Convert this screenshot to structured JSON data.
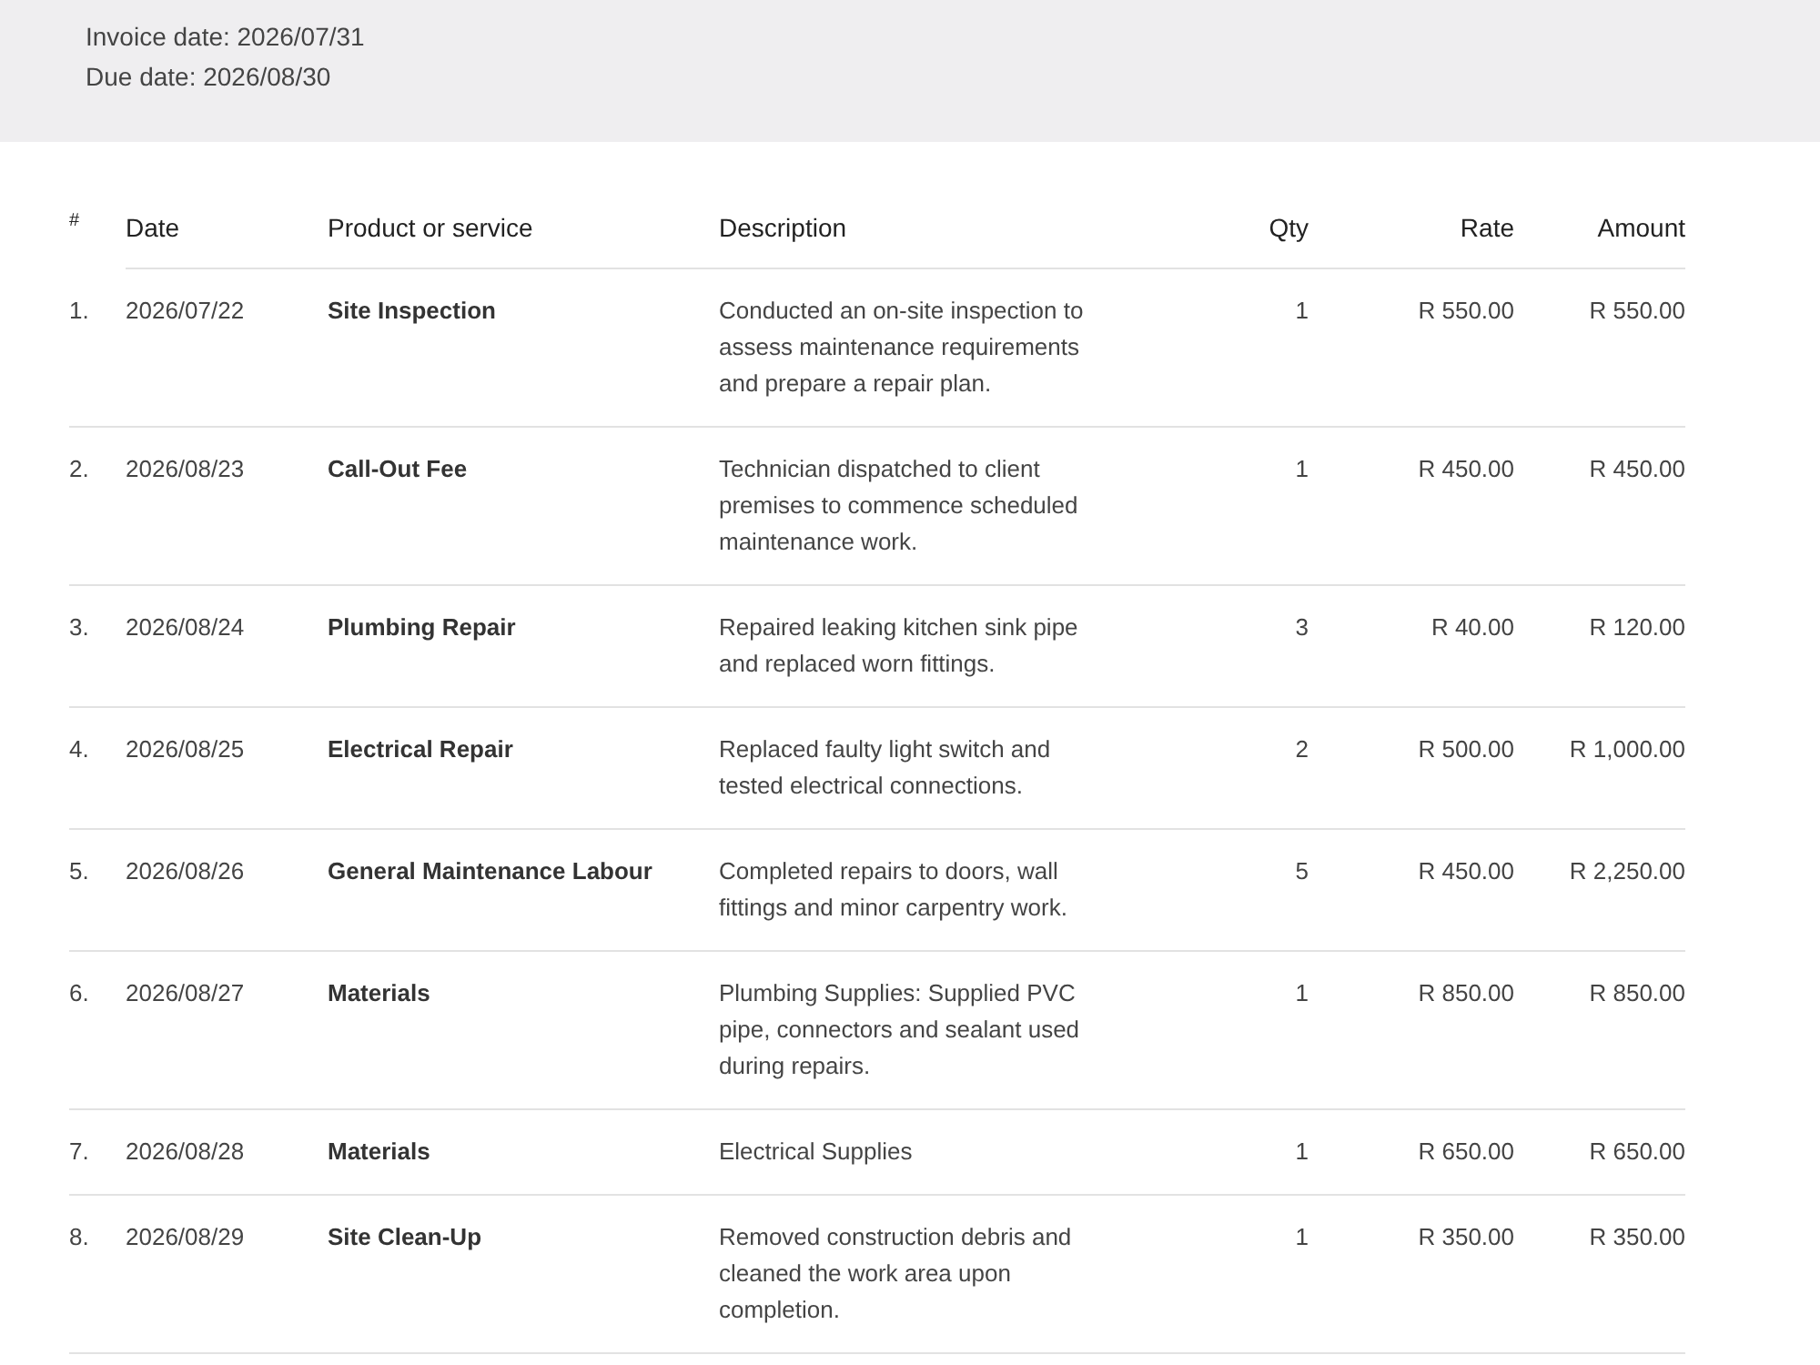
{
  "invoice_info": [
    "Invoice date: 2026/07/31",
    "Due date: 2026/08/30"
  ],
  "table": {
    "columns": [
      "#",
      "Date",
      "Product or service",
      "Description",
      "Qty",
      "Rate",
      "Amount"
    ],
    "rows": [
      {
        "number": "1.",
        "date": "2026/07/22",
        "product": "Site Inspection",
        "description": "Conducted an on-site inspection to assess maintenance requirements and prepare a repair plan.",
        "qty": "1",
        "rate": "R 550.00",
        "amount": "R 550.00"
      },
      {
        "number": "2.",
        "date": "2026/08/23",
        "product": "Call-Out Fee",
        "description": "Technician dispatched to client premises to commence scheduled maintenance work.",
        "qty": "1",
        "rate": "R 450.00",
        "amount": "R 450.00"
      },
      {
        "number": "3.",
        "date": "2026/08/24",
        "product": "Plumbing Repair",
        "description": "Repaired leaking kitchen sink pipe and replaced worn fittings.",
        "qty": "3",
        "rate": "R 40.00",
        "amount": "R 120.00"
      },
      {
        "number": "4.",
        "date": "2026/08/25",
        "product": "Electrical Repair",
        "description": "Replaced faulty light switch and tested electrical connections.",
        "qty": "2",
        "rate": "R 500.00",
        "amount": "R 1,000.00"
      },
      {
        "number": "5.",
        "date": "2026/08/26",
        "product": "General Maintenance Labour",
        "description": "Completed repairs to doors, wall fittings and minor carpentry work.",
        "qty": "5",
        "rate": "R 450.00",
        "amount": "R 2,250.00"
      },
      {
        "number": "6.",
        "date": "2026/08/27",
        "product": "Materials",
        "description": "Plumbing Supplies: Supplied PVC pipe, connectors and sealant used during repairs.",
        "qty": "1",
        "rate": "R 850.00",
        "amount": "R 850.00"
      },
      {
        "number": "7.",
        "date": "2026/08/28",
        "product": "Materials",
        "description": "Electrical Supplies",
        "qty": "1",
        "rate": "R 650.00",
        "amount": "R 650.00"
      },
      {
        "number": "8.",
        "date": "2026/08/29",
        "product": "Site Clean-Up",
        "description": "Removed construction debris and cleaned the work area upon completion.",
        "qty": "1",
        "rate": "R 350.00",
        "amount": "R 350.00"
      }
    ]
  }
}
